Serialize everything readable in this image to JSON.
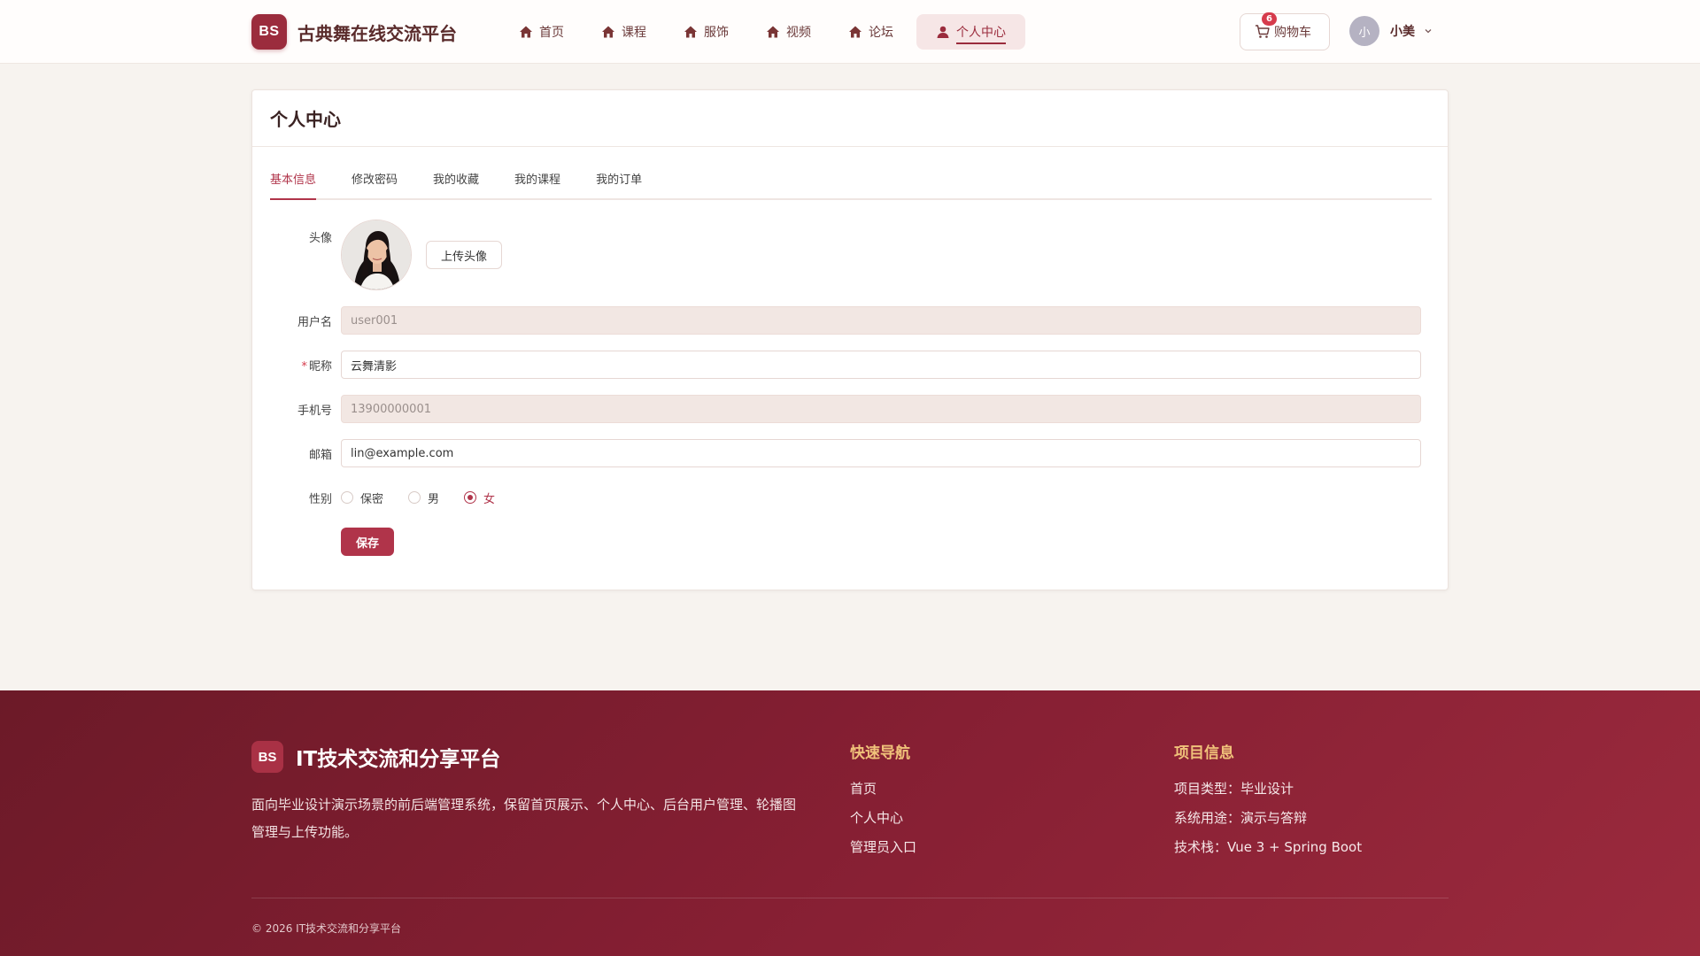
{
  "header": {
    "logo_text": "BS",
    "brand_title": "古典舞在线交流平台",
    "nav": [
      {
        "label": "首页",
        "icon": "home-icon"
      },
      {
        "label": "课程",
        "icon": "home-icon"
      },
      {
        "label": "服饰",
        "icon": "home-icon"
      },
      {
        "label": "视频",
        "icon": "home-icon"
      },
      {
        "label": "论坛",
        "icon": "home-icon"
      },
      {
        "label": "个人中心",
        "icon": "user-icon",
        "active": true
      }
    ],
    "cart": {
      "label": "购物车",
      "count": "6"
    },
    "user": {
      "avatar_text": "小",
      "name": "小美"
    }
  },
  "profile": {
    "title": "个人中心",
    "tabs": [
      "基本信息",
      "修改密码",
      "我的收藏",
      "我的课程",
      "我的订单"
    ],
    "active_tab": "基本信息",
    "avatar_label": "头像",
    "upload_label": "上传头像",
    "fields": {
      "username": {
        "label": "用户名",
        "value": "user001"
      },
      "nickname": {
        "label": "昵称",
        "value": "云舞清影",
        "required": "*"
      },
      "phone": {
        "label": "手机号",
        "value": "13900000001"
      },
      "email": {
        "label": "邮箱",
        "value": "lin@example.com"
      }
    },
    "gender": {
      "label": "性别",
      "options": [
        "保密",
        "男",
        "女"
      ],
      "selected": "女"
    },
    "save_label": "保存"
  },
  "footer": {
    "logo_text": "BS",
    "title": "IT技术交流和分享平台",
    "description": "面向毕业设计演示场景的前后端管理系统，保留首页展示、个人中心、后台用户管理、轮播图管理与上传功能。",
    "quick_nav": {
      "title": "快速导航",
      "links": [
        "首页",
        "个人中心",
        "管理员入口"
      ]
    },
    "project_info": {
      "title": "项目信息",
      "items": [
        "项目类型：毕业设计",
        "系统用途：演示与答辩",
        "技术栈：Vue 3 + Spring Boot"
      ]
    },
    "copyright": "© 2026 IT技术交流和分享平台"
  },
  "colors": {
    "brand": "#9b2c3d",
    "accent": "#b0344a",
    "footer_heading": "#f0c27a"
  }
}
